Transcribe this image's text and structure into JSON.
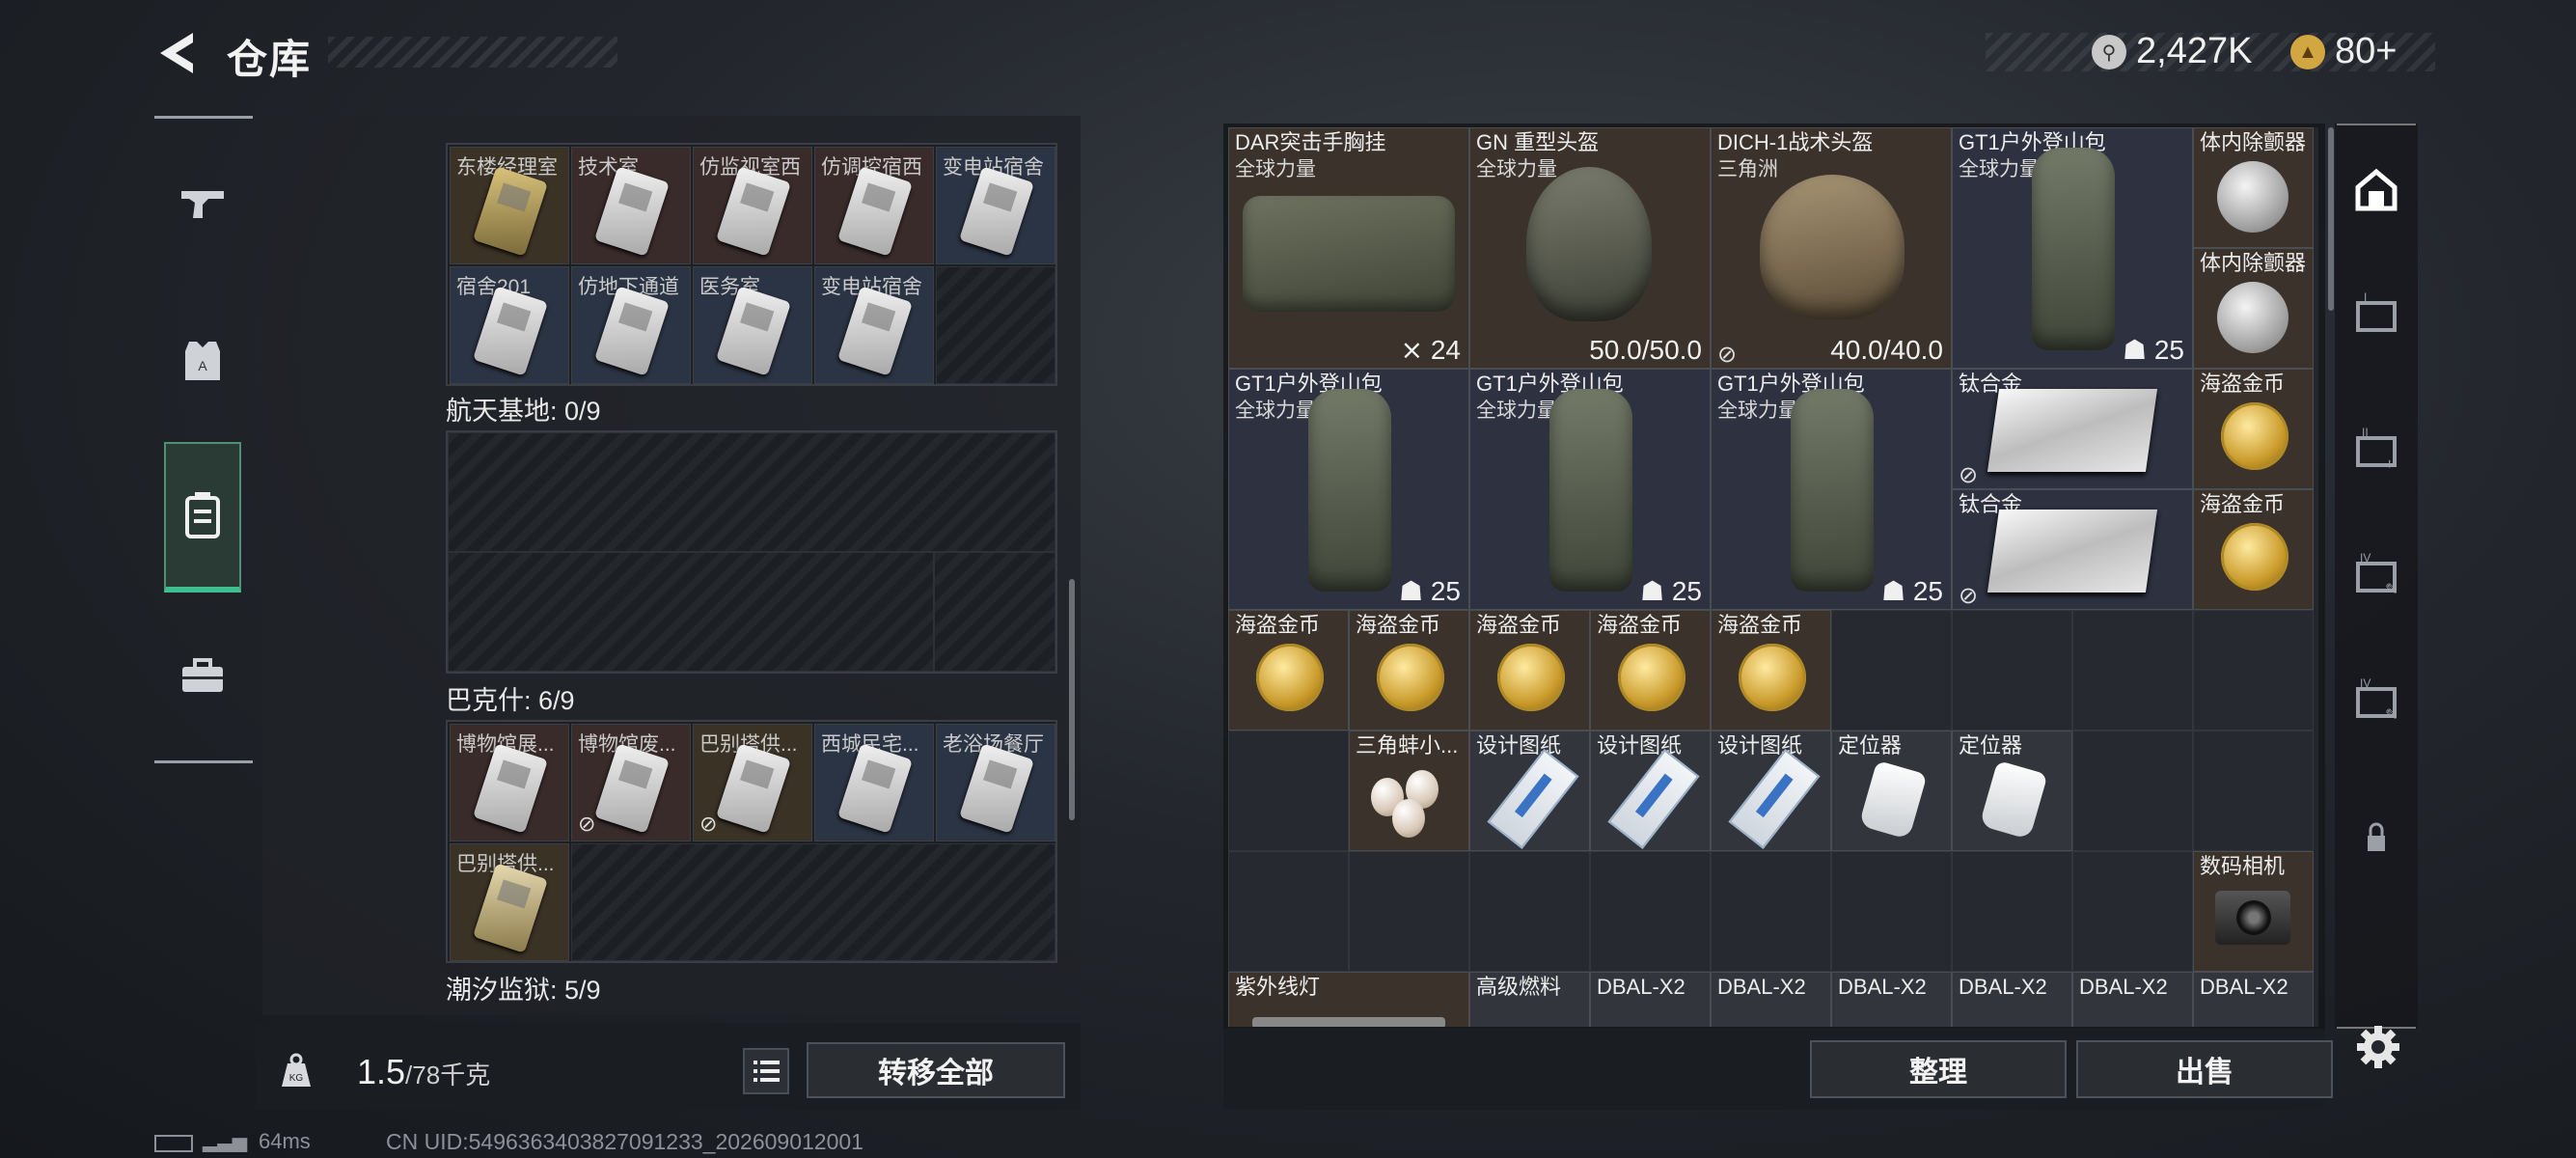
{
  "header": {
    "title": "仓库",
    "currency": [
      {
        "icon": "silver-coin-icon",
        "value": "2,427K"
      },
      {
        "icon": "gold-coin-icon",
        "value": "80+"
      }
    ]
  },
  "left_nav": {
    "items": [
      {
        "name": "weapons-tab",
        "icon": "gun-icon"
      },
      {
        "name": "equipment-tab",
        "icon": "armor-icon"
      },
      {
        "name": "keycards-tab",
        "icon": "keycard-icon",
        "active": true
      },
      {
        "name": "toolbox-tab",
        "icon": "toolbox-icon"
      }
    ]
  },
  "keycard_sections": {
    "top_cards_row1": [
      "东楼经理室",
      "技术室",
      "仿监视室西",
      "仿调控宿西",
      "变电站宿舍"
    ],
    "top_cards_row2": [
      "宿舍201",
      "仿地下通道",
      "医务室",
      "变电站宿舍"
    ],
    "s2_label": "航天基地: 0/9",
    "s3_label": "巴克什: 6/9",
    "s3_cards": [
      "博物馆展...",
      "博物馆废...",
      "巴别塔供...",
      "西城民宅...",
      "老浴场餐厅",
      "巴别塔供..."
    ],
    "s4_label": "潮汐监狱: 5/9"
  },
  "left_footer": {
    "weight_value": "1.5",
    "weight_max": "/78千克",
    "transfer_all": "转移全部"
  },
  "inventory": {
    "big_items": [
      {
        "name": "DAR突击手胸挂",
        "sub": "全球力量",
        "value": "24",
        "icon": "vest-icon"
      },
      {
        "name": "GN 重型头盔",
        "sub": "全球力量",
        "value": "50.0/50.0"
      },
      {
        "name": "DICH-1战术头盔",
        "sub": "三角洲",
        "value": "40.0/40.0"
      },
      {
        "name": "GT1户外登山包",
        "sub": "全球力量",
        "value": "25"
      },
      {
        "name": "GT1户外登山包",
        "sub": "全球力量",
        "value": "25"
      },
      {
        "name": "GT1户外登山包",
        "sub": "全球力量",
        "value": "25"
      },
      {
        "name": "GT1户外登山包",
        "sub": "全球力量",
        "value": "25"
      }
    ],
    "defibrillator": "体内除颤器",
    "titanium": "钛合金",
    "pirate_coin": "海盗金币",
    "triangle_pearl": "三角蚌小...",
    "blueprint": "设计图纸",
    "locator": "定位器",
    "camera": "数码相机",
    "uv_lamp": "紫外线灯",
    "fuel": "高级燃料",
    "dbal": "DBAL-X2"
  },
  "right_footer": {
    "sort": "整理",
    "sell": "出售"
  },
  "status_bar": {
    "ping": "64ms",
    "uid": "CN UID:5496363403827091233_202609012001"
  },
  "colors": {
    "accent_green": "#3fbf8f",
    "gold": "#c99a2a",
    "panel": "#23262b"
  }
}
